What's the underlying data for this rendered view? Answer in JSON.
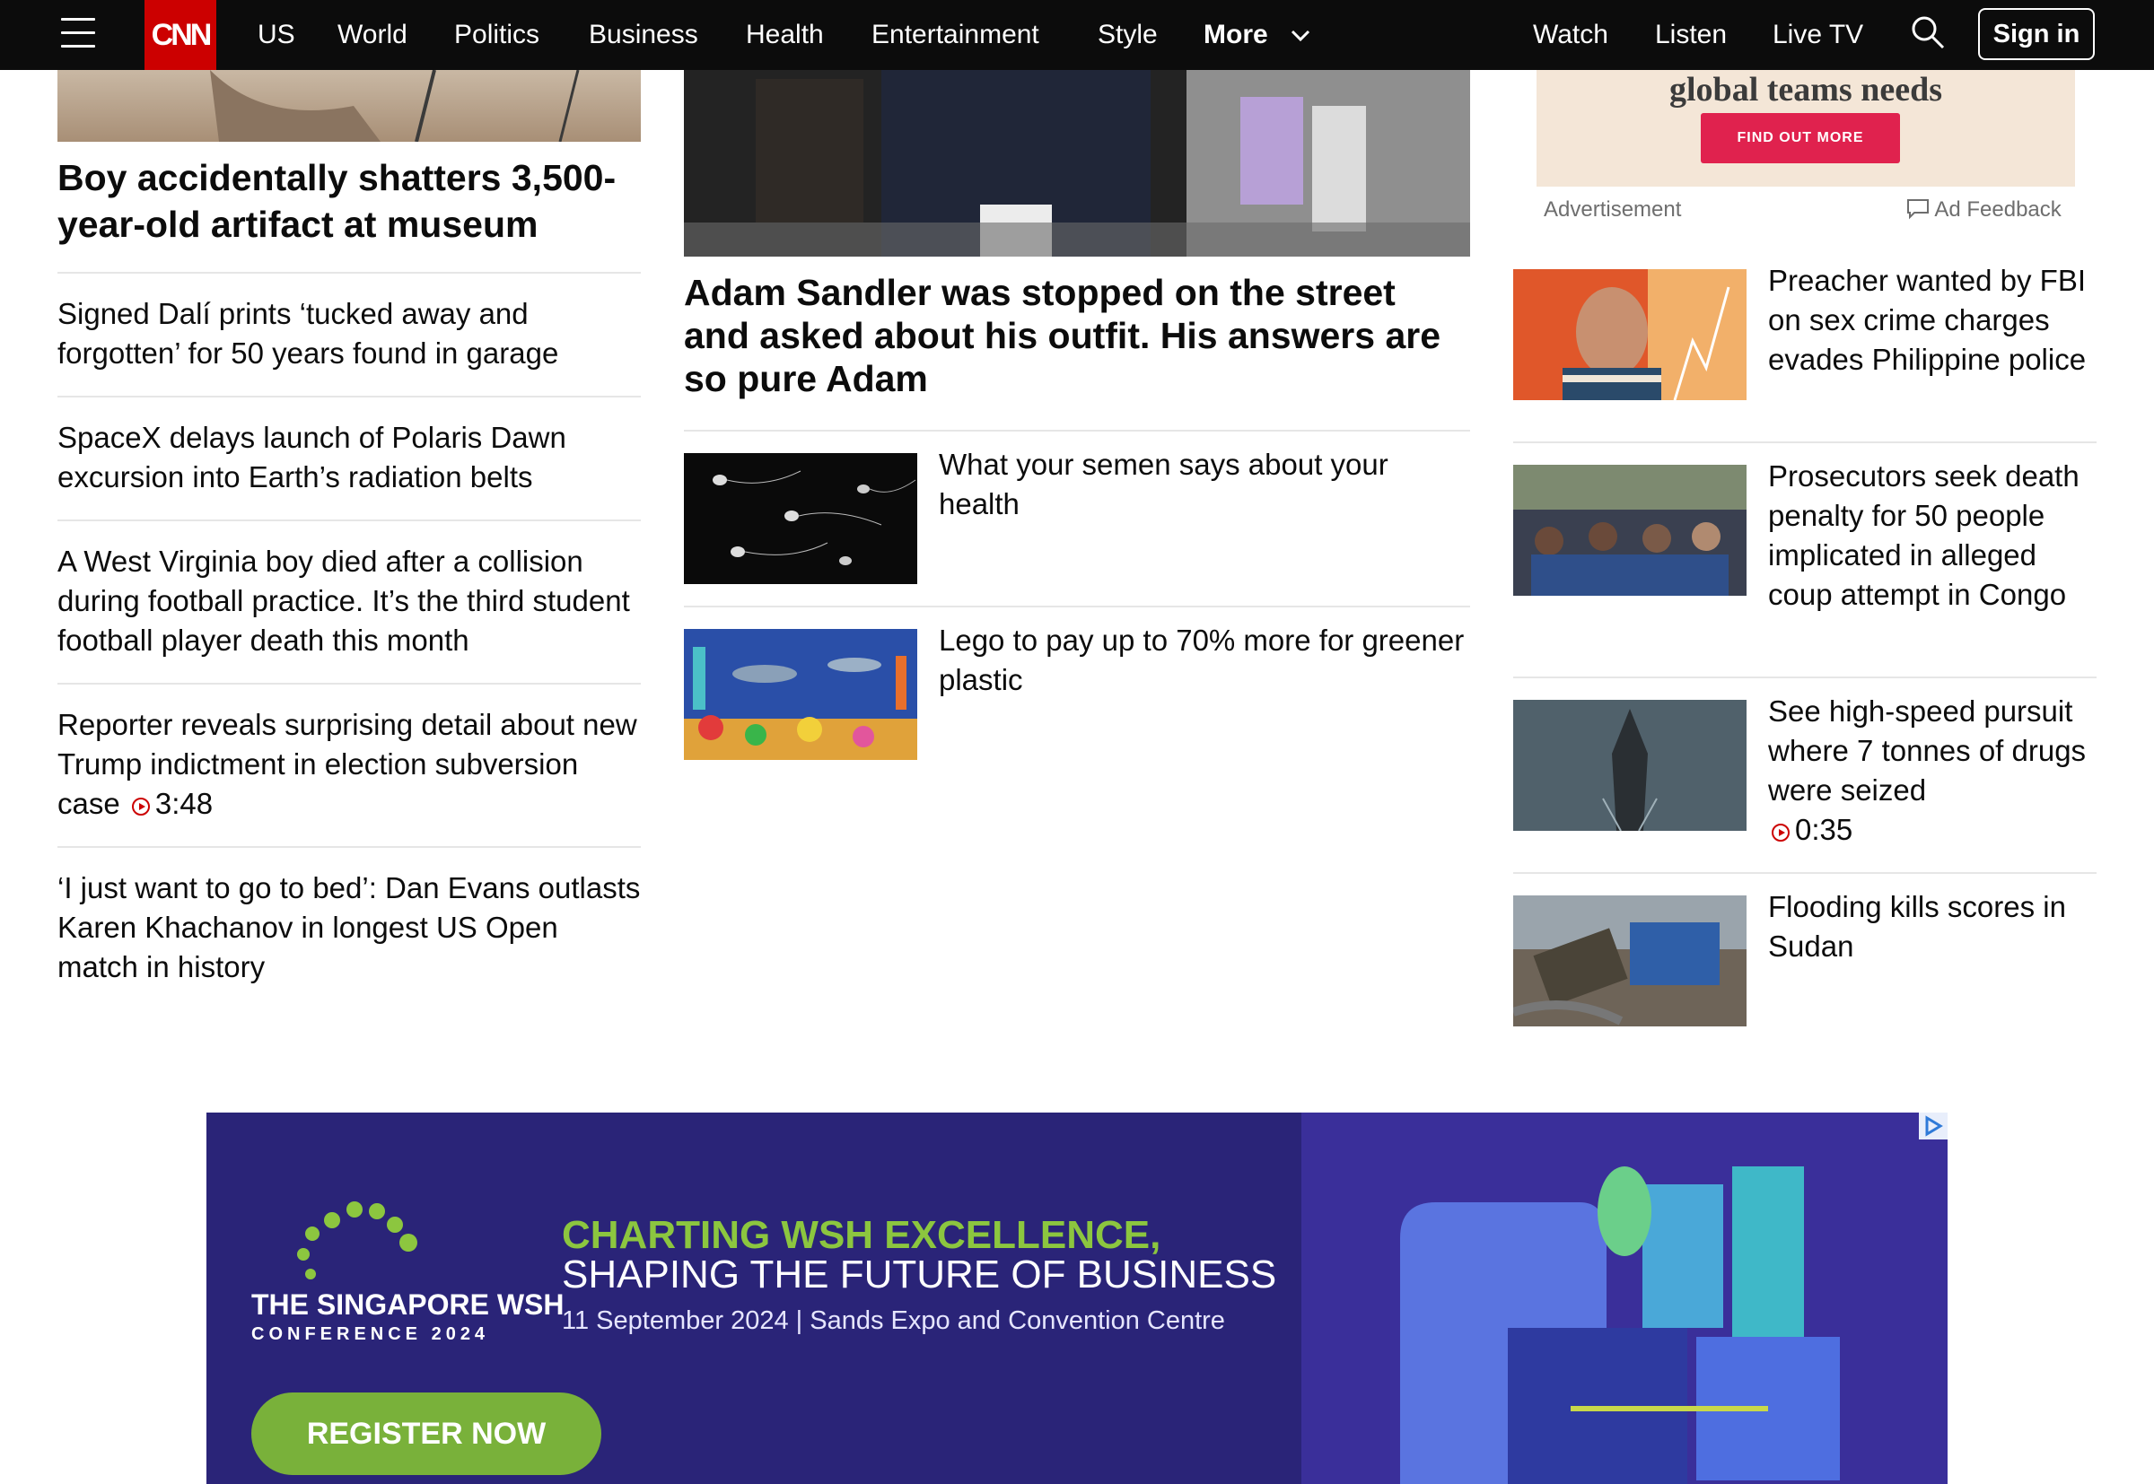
{
  "nav": {
    "logo": "CNN",
    "items": [
      "US",
      "World",
      "Politics",
      "Business",
      "Health",
      "Entertainment",
      "Style"
    ],
    "more": "More",
    "right": [
      "Watch",
      "Listen",
      "Live TV"
    ],
    "sign_in": "Sign in"
  },
  "left_column": {
    "lead_headline": "Boy accidentally shatters 3,500-year-old artifact at museum",
    "stories": [
      {
        "text": "Signed Dalí prints ‘tucked away and forgotten’ for 50 years found in garage"
      },
      {
        "text": "SpaceX delays launch of Polaris Dawn excursion into Earth’s radiation belts"
      },
      {
        "text": "A West Virginia boy died after a collision during football practice. It’s the third student football player death this month"
      },
      {
        "text": "Reporter reveals surprising detail about new Trump indictment in election subversion case",
        "video_duration": "3:48"
      },
      {
        "text": "‘I just want to go to bed’: Dan Evans outlasts Karen Khachanov in longest US Open match in history"
      }
    ]
  },
  "center_column": {
    "lead_headline": "Adam Sandler was stopped on the street and asked about his outfit. His answers are so pure Adam",
    "stories": [
      {
        "text": "What your semen says about your health"
      },
      {
        "text": "Lego to pay up to 70% more for greener plastic"
      }
    ]
  },
  "right_column": {
    "ad": {
      "text": "global teams needs",
      "button": "FIND OUT MORE",
      "label": "Advertisement",
      "feedback": "Ad Feedback"
    },
    "stories": [
      {
        "text": "Preacher wanted by FBI on sex crime charges evades Philippine police"
      },
      {
        "text": "Prosecutors seek death penalty for 50 people implicated in alleged coup attempt in Congo"
      },
      {
        "text": "See high-speed pursuit where 7 tonnes of drugs were seized",
        "video_duration": "0:35"
      },
      {
        "text": "Flooding kills scores in Sudan"
      }
    ]
  },
  "banner_ad": {
    "logo_line1": "THE SINGAPORE WSH",
    "logo_line2": "CONFERENCE 2024",
    "headline1": "CHARTING WSH EXCELLENCE,",
    "headline2": "SHAPING THE FUTURE OF BUSINESS",
    "details": "11 September 2024 |  Sands Expo and Convention Centre",
    "cta": "REGISTER NOW"
  },
  "colors": {
    "nav_bg": "#0c0c0c",
    "brand_red": "#cc0000",
    "banner_bg": "#2a2478",
    "banner_green": "#8cc63f",
    "ad_button": "#e0224e"
  }
}
